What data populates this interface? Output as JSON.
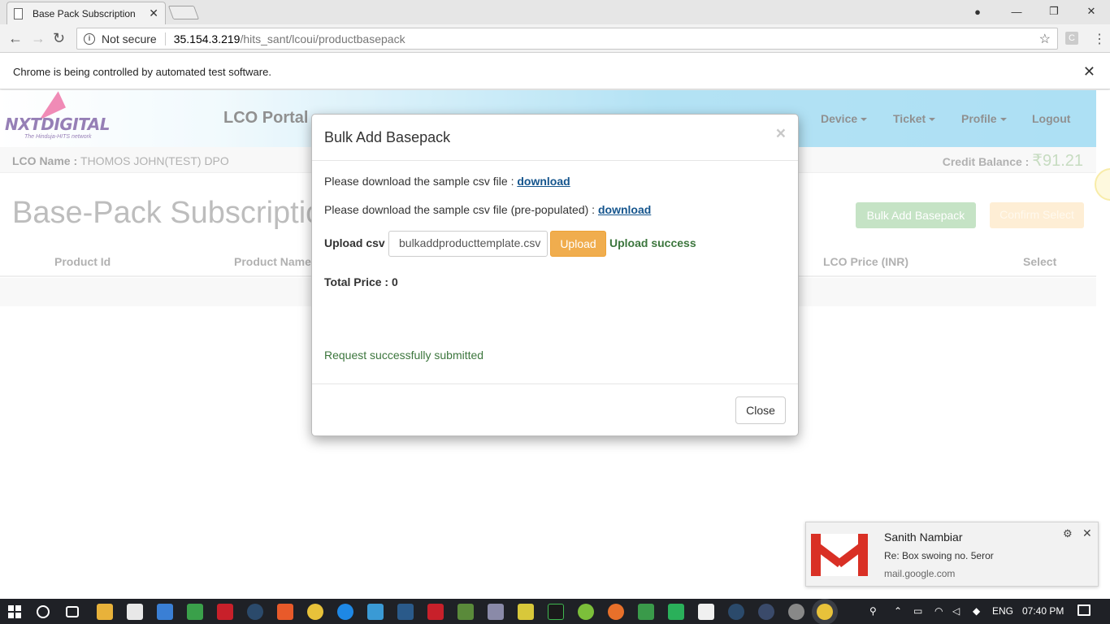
{
  "browser": {
    "tab_title": "Base Pack Subscription",
    "security_label": "Not secure",
    "url_host": "35.154.3.219",
    "url_path": "/hits_sant/lcoui/productbasepack",
    "extension_letter": "C",
    "infobar_message": "Chrome is being controlled by automated test software."
  },
  "header": {
    "logo_text": "NXTDIGITAL",
    "logo_tagline": "The Hinduja-HITS network",
    "portal_title": "LCO Portal",
    "nav": {
      "device": "Device",
      "ticket": "Ticket",
      "profile": "Profile",
      "logout": "Logout"
    }
  },
  "subbar": {
    "lco_name_label": "LCO Name :",
    "lco_name_value": "THOMOS JOHN(TEST) DPO",
    "credit_label": "Credit Balance :",
    "credit_value": "₹91.21"
  },
  "main": {
    "heading": "Base-Pack Subscription",
    "bulk_button": "Bulk Add Basepack",
    "confirm_button": "Confirm Select",
    "columns": {
      "product_id": "Product Id",
      "product_name": "Product Name",
      "lco_price": "LCO Price (INR)",
      "select": "Select"
    }
  },
  "modal": {
    "title": "Bulk Add Basepack",
    "close_x": "×",
    "line1_text": "Please download the sample csv file :",
    "line1_link": "download",
    "line2_text": "Please download the sample csv file (pre-populated) :",
    "line2_link": "download",
    "upload_label": "Upload csv",
    "file_name": "bulkaddproducttemplate.csv",
    "upload_button": "Upload",
    "upload_status": "Upload success",
    "total_price": "Total Price : 0",
    "request_message": "Request successfully submitted",
    "close_button": "Close"
  },
  "notification": {
    "sender": "Sanith Nambiar",
    "subject": "Re: Box swoing no. 5eror",
    "source": "mail.google.com"
  },
  "taskbar": {
    "language": "ENG",
    "time": "07:40 PM"
  },
  "colors": {
    "header_gradient_end": "#81cfee",
    "bulk_button_bg": "#a7d5a7",
    "confirm_button_bg": "#fde5bf",
    "upload_button_bg": "#f0ad4e",
    "success_text": "#3c763d",
    "link_color": "#15558d",
    "gmail_red": "#d93025"
  }
}
